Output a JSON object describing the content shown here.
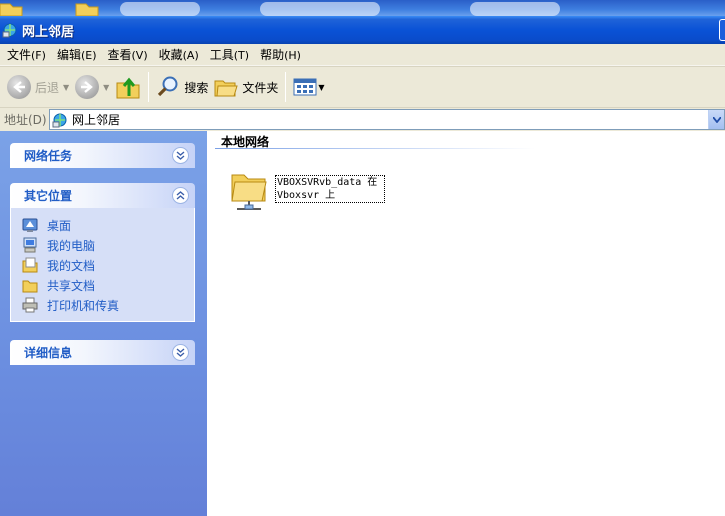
{
  "window": {
    "title": "网上邻居",
    "colors": {
      "titlebar": "#0a52d6",
      "taskpane": "#6b8ee0",
      "link": "#215dc6",
      "chrome": "#ece9d8"
    }
  },
  "menu": [
    {
      "label": "文件",
      "accel": "(F)"
    },
    {
      "label": "编辑",
      "accel": "(E)"
    },
    {
      "label": "查看",
      "accel": "(V)"
    },
    {
      "label": "收藏",
      "accel": "(A)"
    },
    {
      "label": "工具",
      "accel": "(T)"
    },
    {
      "label": "帮助",
      "accel": "(H)"
    }
  ],
  "toolbar": {
    "back_label": "后退",
    "search_label": "搜索",
    "folders_label": "文件夹"
  },
  "address": {
    "label": "地址(D)",
    "value": "网上邻居"
  },
  "taskpane": {
    "network_tasks": {
      "title": "网络任务",
      "icon": "chevron-down-icon"
    },
    "other_places": {
      "title": "其它位置",
      "icon": "chevron-up-icon",
      "items": [
        {
          "label": "桌面",
          "icon": "desktop-icon"
        },
        {
          "label": "我的电脑",
          "icon": "my-computer-icon"
        },
        {
          "label": "我的文档",
          "icon": "my-documents-icon"
        },
        {
          "label": "共享文档",
          "icon": "shared-documents-icon"
        },
        {
          "label": "打印机和传真",
          "icon": "printer-icon"
        }
      ]
    },
    "details": {
      "title": "详细信息",
      "icon": "chevron-down-icon"
    }
  },
  "content": {
    "section_title": "本地网络",
    "items": [
      {
        "label": "VBOXSVRvb_data 在\nVboxsvr 上",
        "icon": "network-share-icon"
      }
    ]
  }
}
